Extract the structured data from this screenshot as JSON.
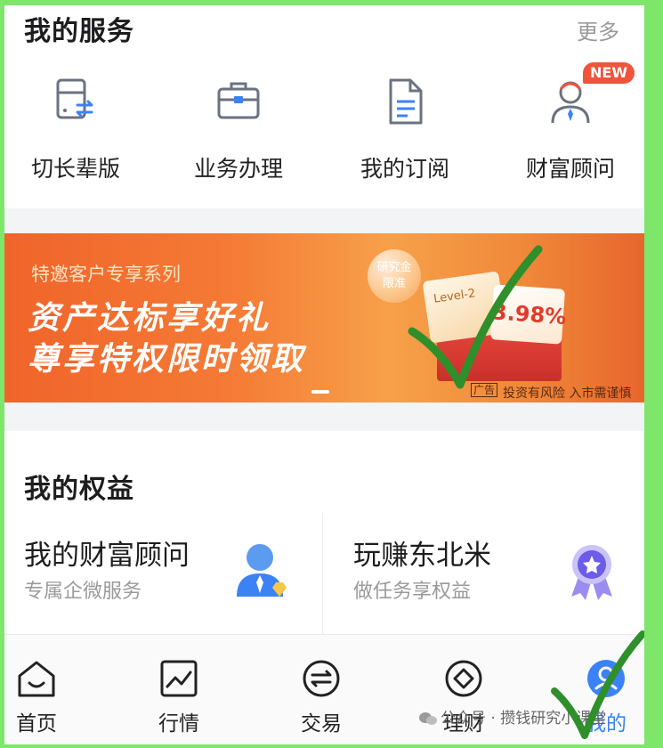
{
  "services": {
    "title": "我的服务",
    "more": "更多",
    "items": [
      {
        "label": "切长辈版",
        "icon": "elder-mode-icon"
      },
      {
        "label": "业务办理",
        "icon": "briefcase-icon"
      },
      {
        "label": "我的订阅",
        "icon": "document-icon"
      },
      {
        "label": "财富顾问",
        "icon": "advisor-icon",
        "badge": "NEW"
      }
    ]
  },
  "banner": {
    "subtitle": "特邀客户专享系列",
    "line1": "资产达标享好礼",
    "line2": "尊享特权限时领取",
    "product_tag": "Level-2",
    "rate": "3.98%",
    "bubble": "研究金\n限准",
    "ad_tag": "广告",
    "risk_note": "投资有风险 入市需谨慎"
  },
  "benefits": {
    "title": "我的权益",
    "cards": [
      {
        "title": "我的财富顾问",
        "subtitle": "专属企微服务",
        "icon": "advisor-avatar-icon"
      },
      {
        "title": "玩赚东北米",
        "subtitle": "做任务享权益",
        "icon": "medal-icon"
      }
    ]
  },
  "tabbar": {
    "tabs": [
      {
        "label": "首页",
        "icon": "home-icon"
      },
      {
        "label": "行情",
        "icon": "market-chart-icon"
      },
      {
        "label": "交易",
        "icon": "trade-icon"
      },
      {
        "label": "理财",
        "icon": "wealth-icon"
      },
      {
        "label": "我的",
        "icon": "profile-icon",
        "active": true
      }
    ]
  },
  "watermark": "公众号 · 攒钱研究小课堂",
  "colors": {
    "frame_green": "#7ee66a",
    "check_green": "#2f8f2a",
    "banner_orange": "#f0642a",
    "badge_red": "#f0543b",
    "icon_blue": "#3b82f6",
    "icon_gray": "#6b7280"
  }
}
